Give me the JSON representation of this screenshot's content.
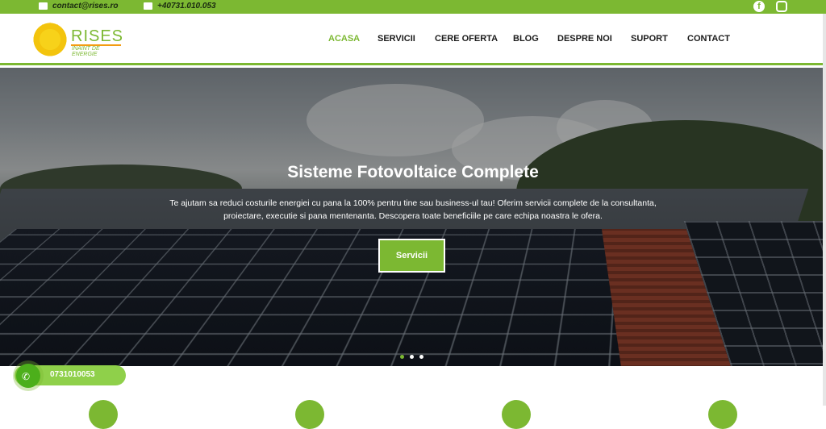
{
  "topbar": {
    "email": "contact@rises.ro",
    "phone": "+40731.010.053",
    "email_icon": "envelope-icon",
    "phone_icon": "phone-icon",
    "social": [
      "facebook-icon",
      "instagram-icon"
    ]
  },
  "logo": {
    "brand": "RISES",
    "tagline": "INAINT DE ENERGIE"
  },
  "nav": [
    "ACASA",
    "SERVICII",
    "CERE OFERTA",
    "BLOG",
    "DESPRE NOI",
    "SUPORT",
    "CONTACT"
  ],
  "hero": {
    "title": "Sisteme Fotovoltaice Complete",
    "text": "Te ajutam sa reduci costurile energiei cu pana la 100% pentru tine sau business-ul tau! Oferim servicii complete de la consultanta, proiectare, executie si pana mentenanta. Descopera toate beneficiile pe care echipa noastra le ofera.",
    "button": "Servicii",
    "slides": 3,
    "active_slide": 1
  },
  "call_widget": {
    "number": "0731010053"
  },
  "colors": {
    "accent": "#7cb832",
    "nav_text": "#1b1b1b"
  }
}
